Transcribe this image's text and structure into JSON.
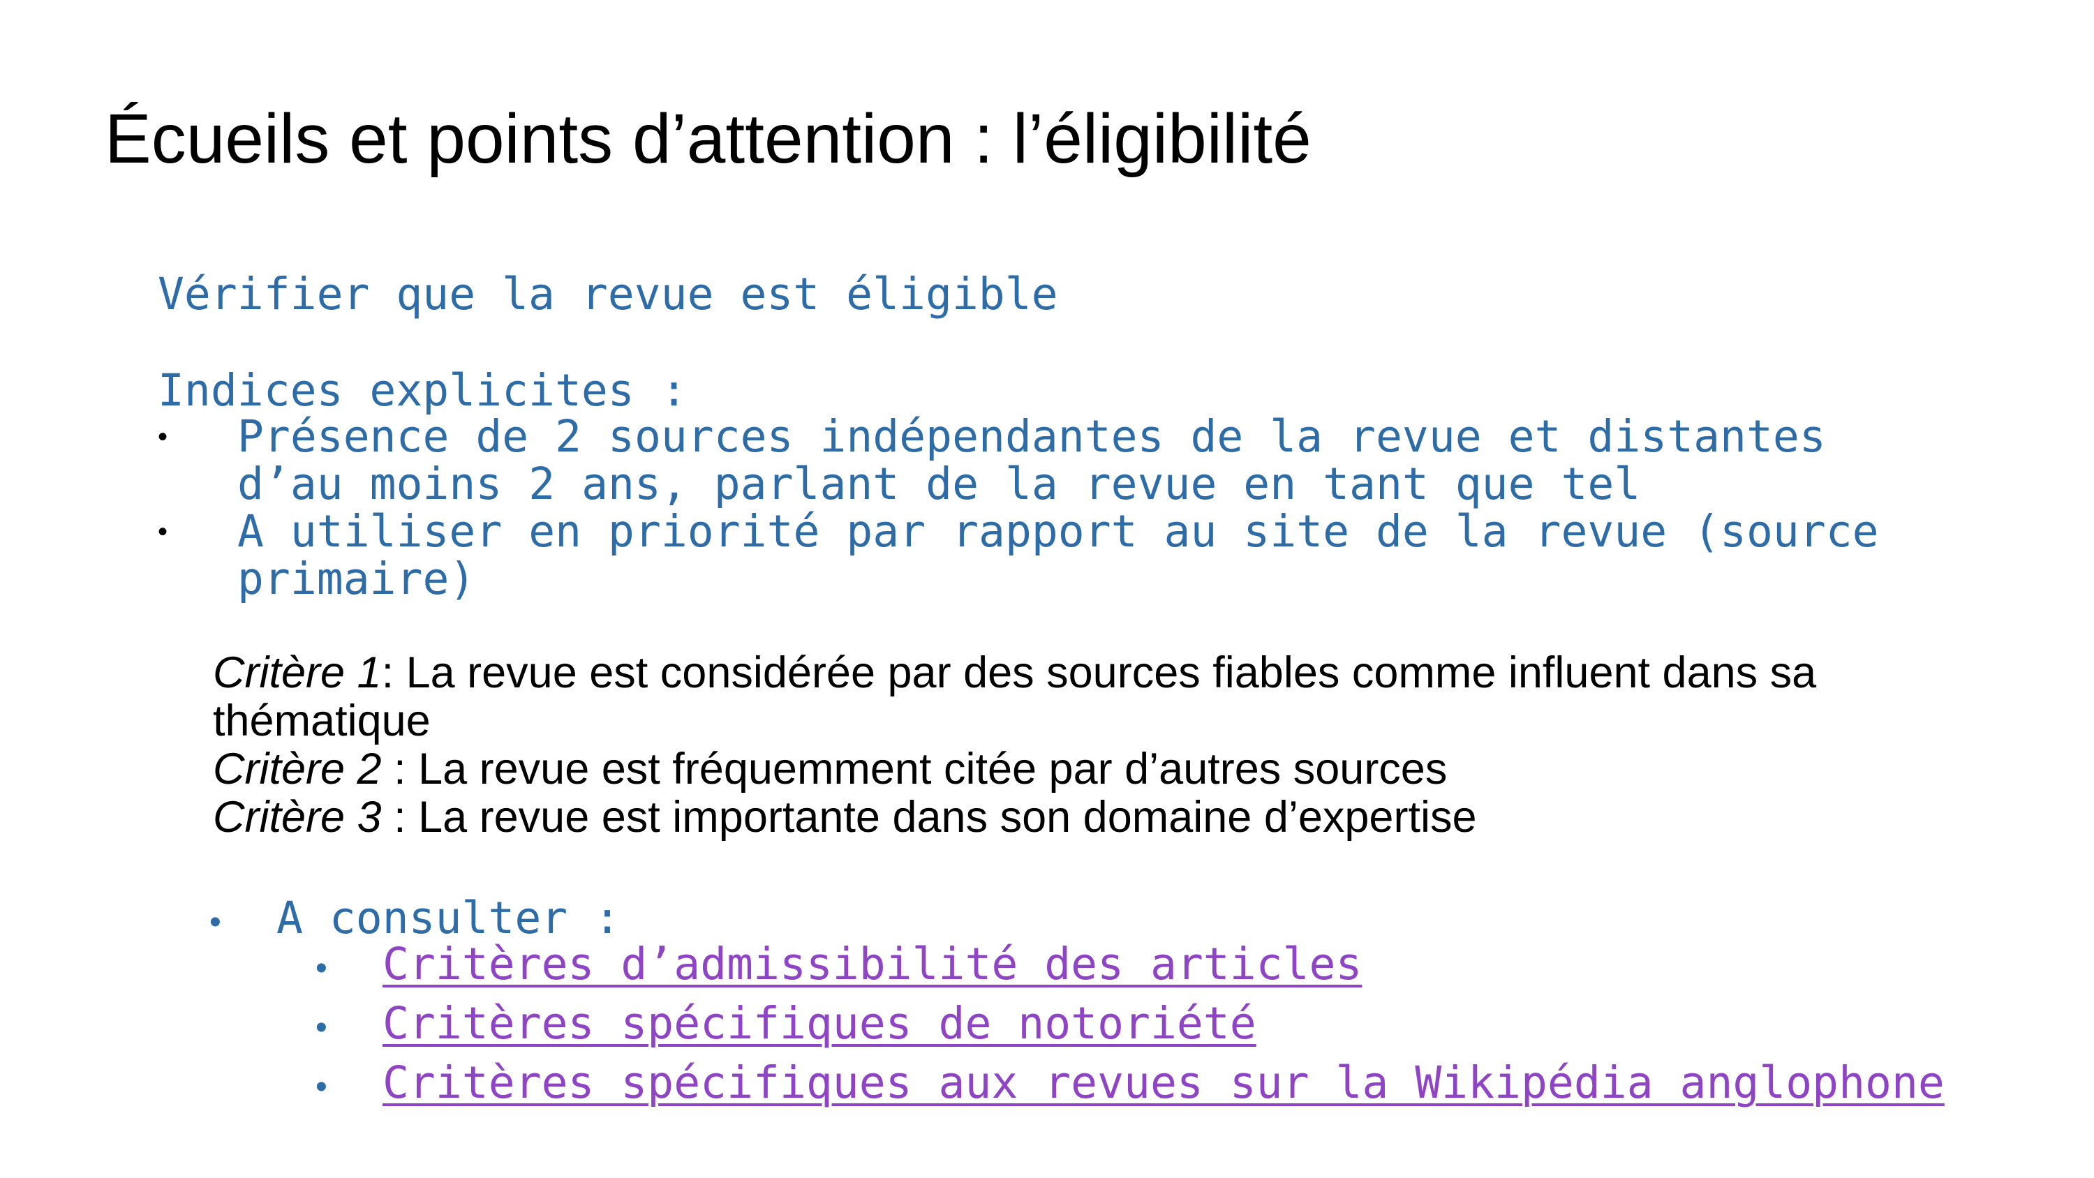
{
  "slide": {
    "title": "Écueils et points d’attention : l’éligibilité",
    "verify": "Vérifier que la revue est éligible",
    "indices_heading": "Indices explicites :",
    "indices": [
      {
        "line1": "Présence de 2 sources indépendantes de la revue et distantes",
        "line2": "d’au moins 2 ans, parlant de la revue en tant que tel"
      },
      {
        "line1": "A utiliser en priorité par rapport au site de la revue (source",
        "line2": "primaire)"
      }
    ],
    "criteria": [
      {
        "label": "Critère 1",
        "text": ": La revue est considérée par des sources fiables comme influent dans sa thématique"
      },
      {
        "label": "Critère 2",
        "text": " : La revue est fréquemment citée par d’autres sources"
      },
      {
        "label": "Critère 3",
        "text": " : La revue est importante dans son domaine d’expertise"
      }
    ],
    "consult_label": "A consulter :",
    "links": [
      "Critères d’admissibilité des articles",
      "Critères spécifiques de notoriété",
      "Critères spécifiques aux revues sur la Wikipédia anglophone"
    ],
    "bullet_char": "•"
  },
  "colors": {
    "title": "#000000",
    "body_blue": "#2e6ca8",
    "link_purple": "#8e44c4",
    "background": "#ffffff"
  }
}
